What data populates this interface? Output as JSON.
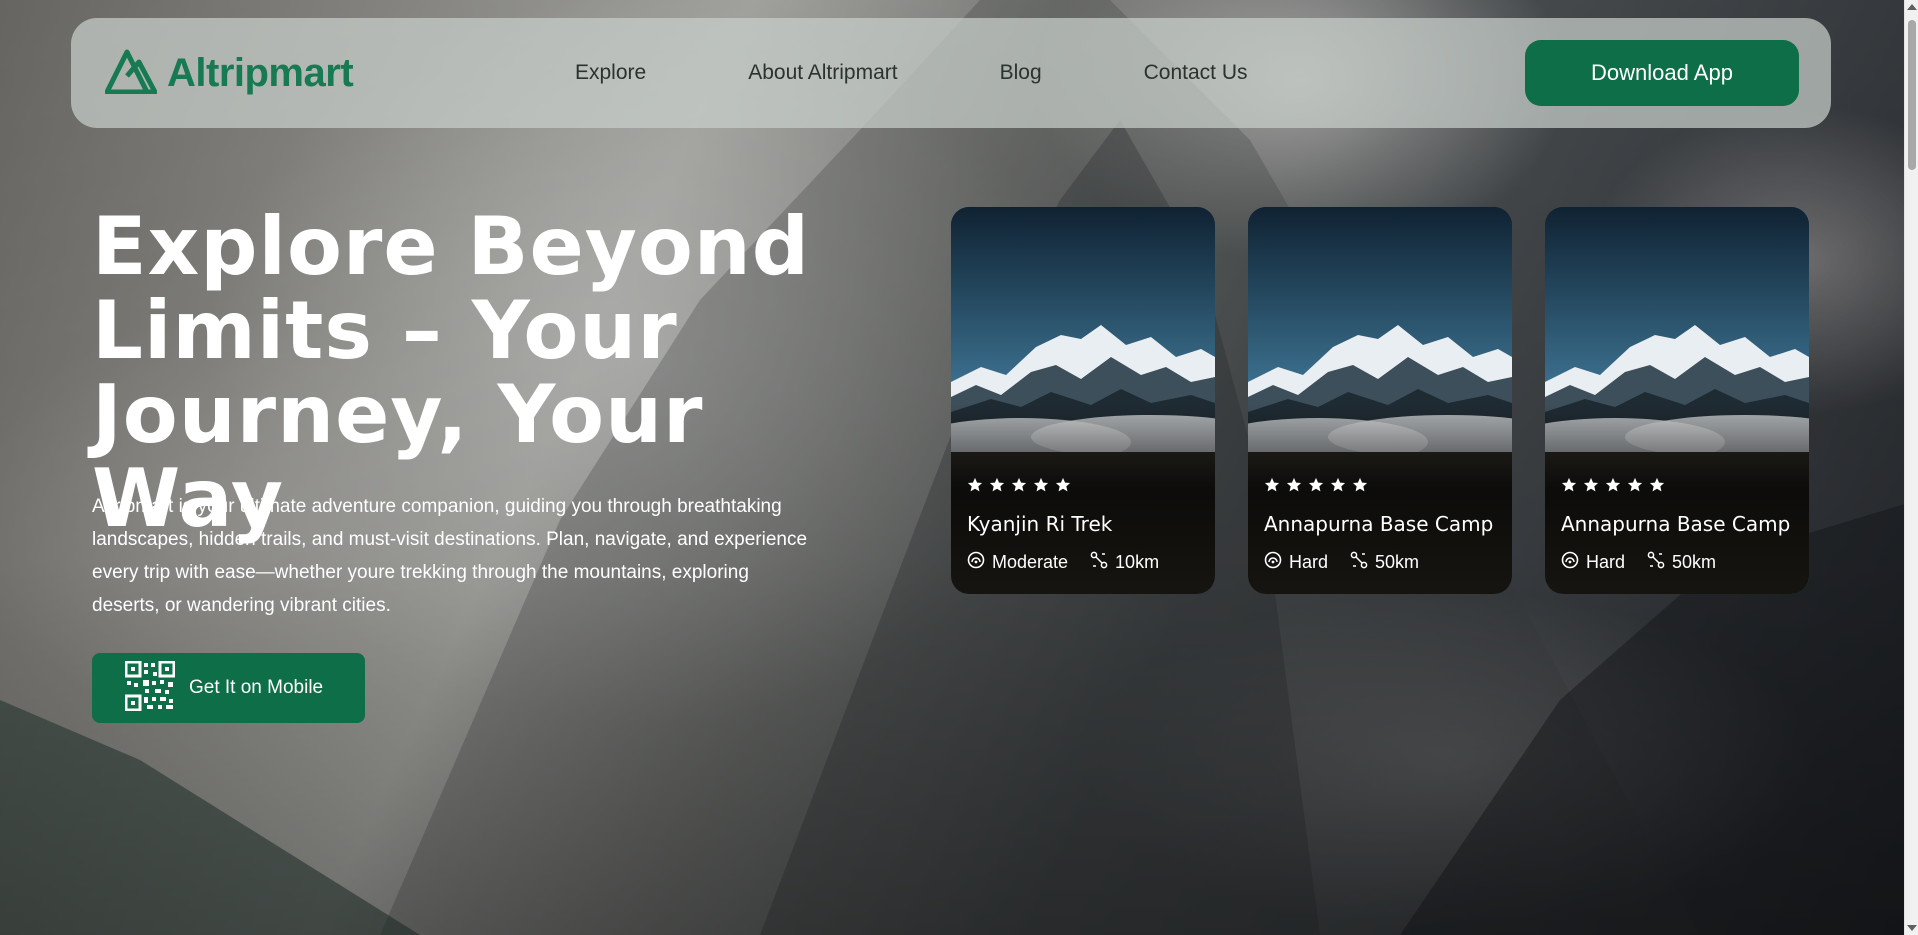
{
  "brand": {
    "name": "Altripmart",
    "logo_icon": "altripmart-mountain-logo",
    "color": "#177a52"
  },
  "nav": {
    "links": [
      "Explore",
      "About Altripmart",
      "Blog",
      "Contact Us"
    ],
    "download_label": "Download App"
  },
  "hero": {
    "title": "Explore Beyond Limits – Your Journey, Your Way",
    "description": "Altripmart is your ultimate adventure companion, guiding you through breathtaking landscapes, hidden trails, and must-visit destinations. Plan, navigate, and experience every trip with ease—whether youre trekking through the mountains, exploring deserts, or wandering vibrant cities.",
    "cta_label": "Get It on Mobile",
    "cta_icon": "qr-code-icon"
  },
  "cards": [
    {
      "title": "Kyanjin Ri Trek",
      "rating": 5,
      "difficulty": "Moderate",
      "distance": "10km"
    },
    {
      "title": "Annapurna Base Camp",
      "rating": 5,
      "difficulty": "Hard",
      "distance": "50km"
    },
    {
      "title": "Annapurna Base Camp",
      "rating": 5,
      "difficulty": "Hard",
      "distance": "50km"
    }
  ],
  "colors": {
    "primary": "#0d6e48",
    "navbar_bg": "#c8ceca"
  }
}
